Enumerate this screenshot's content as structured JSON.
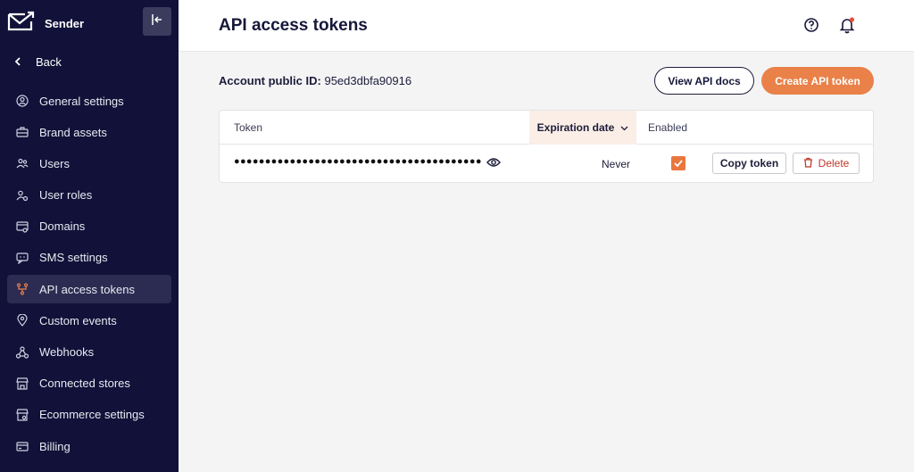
{
  "app": {
    "name": "Sender"
  },
  "sidebar": {
    "back_label": "Back",
    "items": [
      {
        "label": "General settings",
        "icon": "user-circle-icon"
      },
      {
        "label": "Brand assets",
        "icon": "briefcase-icon"
      },
      {
        "label": "Users",
        "icon": "users-icon"
      },
      {
        "label": "User roles",
        "icon": "user-roles-icon"
      },
      {
        "label": "Domains",
        "icon": "domain-icon"
      },
      {
        "label": "SMS settings",
        "icon": "sms-icon"
      },
      {
        "label": "API access tokens",
        "icon": "api-icon",
        "active": true
      },
      {
        "label": "Custom events",
        "icon": "location-pin-icon"
      },
      {
        "label": "Webhooks",
        "icon": "webhook-icon"
      },
      {
        "label": "Connected stores",
        "icon": "store-icon"
      },
      {
        "label": "Ecommerce settings",
        "icon": "ecommerce-icon"
      },
      {
        "label": "Billing",
        "icon": "credit-card-icon"
      }
    ]
  },
  "header": {
    "title": "API access tokens"
  },
  "account": {
    "label": "Account public ID:",
    "value": "95ed3dbfa90916"
  },
  "actions": {
    "view_docs": "View API docs",
    "create_token": "Create API token"
  },
  "table": {
    "columns": {
      "token": "Token",
      "expiration": "Expiration date",
      "enabled": "Enabled"
    },
    "rows": [
      {
        "token_mask": "●●●●●●●●●●●●●●●●●●●●●●●●●●●●●●●●●●●●●●●●",
        "expiration": "Never",
        "enabled": true,
        "copy_label": "Copy token",
        "delete_label": "Delete"
      }
    ]
  },
  "colors": {
    "sidebar_bg": "#111139",
    "accent": "#e98149",
    "danger": "#c0392b"
  }
}
